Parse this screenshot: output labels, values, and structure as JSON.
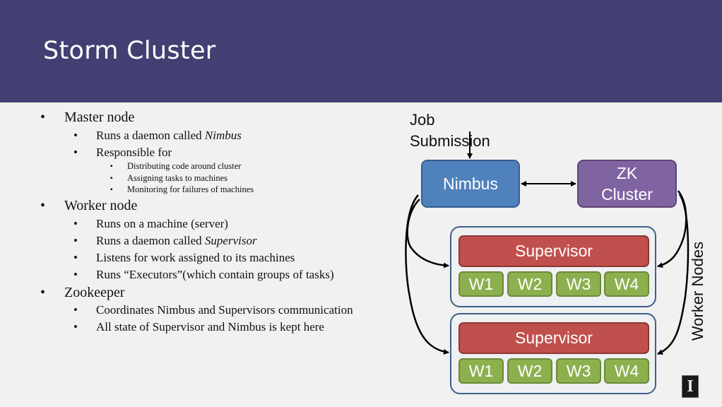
{
  "header": {
    "title": "Storm Cluster",
    "background": "#433f72"
  },
  "bullets": [
    {
      "text": "Master node",
      "children": [
        {
          "text_parts": [
            {
              "t": "Runs a daemon called "
            },
            {
              "t": "Nimbus",
              "italic": true
            }
          ]
        },
        {
          "text_parts": [
            {
              "t": "Responsible for"
            }
          ],
          "children": [
            "Distributing code around cluster",
            "Assigning tasks to machines",
            "Monitoring for failures of machines"
          ]
        }
      ]
    },
    {
      "text": "Worker node",
      "children": [
        {
          "text_parts": [
            {
              "t": "Runs on a machine (server)"
            }
          ]
        },
        {
          "text_parts": [
            {
              "t": "Runs a daemon called "
            },
            {
              "t": "Supervisor",
              "italic": true
            }
          ]
        },
        {
          "text_parts": [
            {
              "t": "Listens for work assigned to its machines"
            }
          ]
        },
        {
          "text_parts": [
            {
              "t": "Runs “Executors”(which contain groups of tasks)"
            }
          ]
        }
      ]
    },
    {
      "text": "Zookeeper",
      "children": [
        {
          "text_parts": [
            {
              "t": "Coordinates Nimbus and Supervisors communication"
            }
          ]
        },
        {
          "text_parts": [
            {
              "t": "All state of Supervisor and Nimbus is kept here"
            }
          ]
        }
      ]
    }
  ],
  "diagram": {
    "job_submission": [
      "Job",
      "Submission"
    ],
    "nimbus": {
      "label": "Nimbus",
      "color": "#4f81bd"
    },
    "zk": {
      "label_lines": [
        "ZK",
        "Cluster"
      ],
      "color": "#8064a2"
    },
    "supervisors": [
      {
        "label": "Supervisor",
        "workers": [
          "W1",
          "W2",
          "W3",
          "W4"
        ]
      },
      {
        "label": "Supervisor",
        "workers": [
          "W1",
          "W2",
          "W3",
          "W4"
        ]
      }
    ],
    "supervisor_color": "#c0504d",
    "worker_color": "#8db04f",
    "side_label": "Worker Nodes",
    "logo": "I"
  }
}
